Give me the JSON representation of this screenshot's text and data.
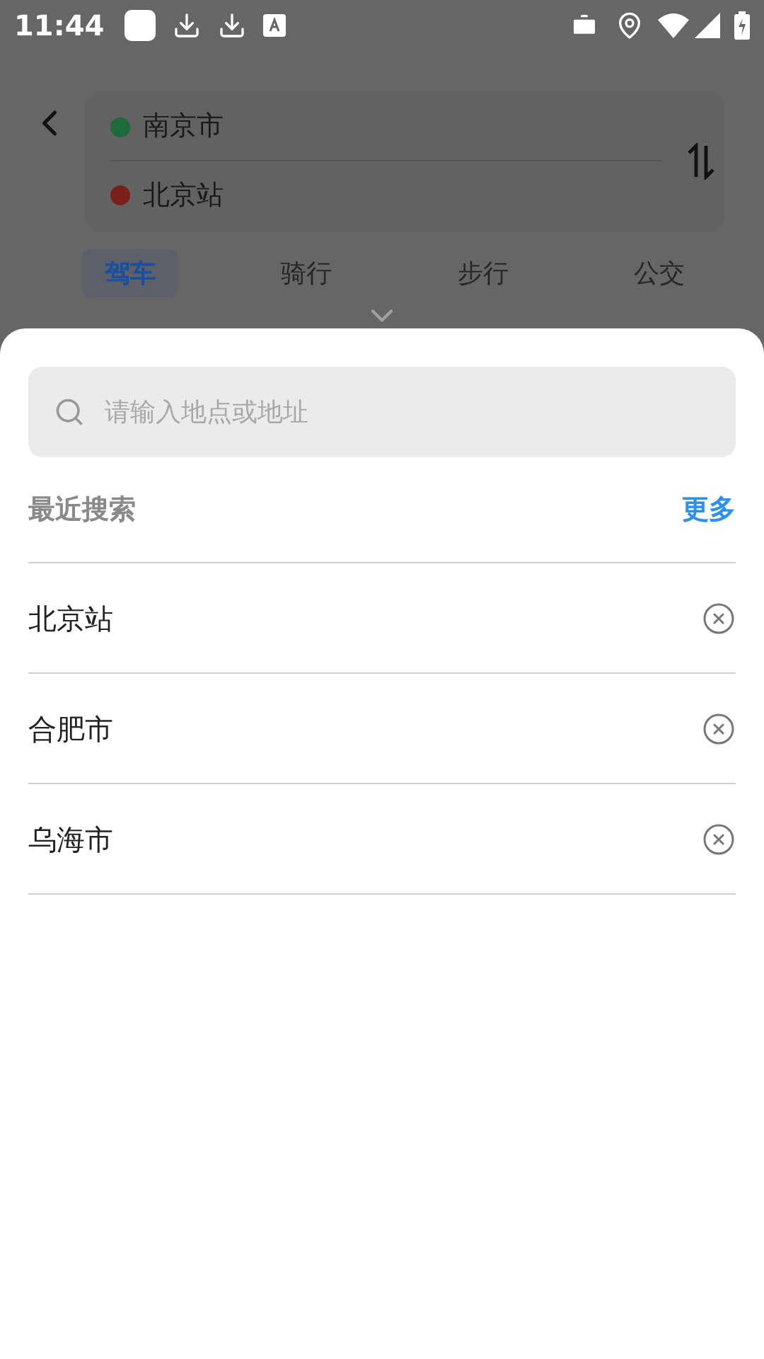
{
  "status_bar": {
    "time": "11:44"
  },
  "route": {
    "origin": {
      "name": "南京市",
      "color": "#1e6b3a"
    },
    "destination": {
      "name": "北京站",
      "color": "#7a1f1a"
    }
  },
  "modes": [
    {
      "label": "驾车",
      "selected": true
    },
    {
      "label": "骑行",
      "selected": false
    },
    {
      "label": "步行",
      "selected": false
    },
    {
      "label": "公交",
      "selected": false
    }
  ],
  "sheet": {
    "search": {
      "placeholder": "请输入地点或地址"
    },
    "recent_title": "最近搜索",
    "more_link": "更多",
    "recent": [
      {
        "name": "北京站"
      },
      {
        "name": "合肥市"
      },
      {
        "name": "乌海市"
      }
    ]
  }
}
